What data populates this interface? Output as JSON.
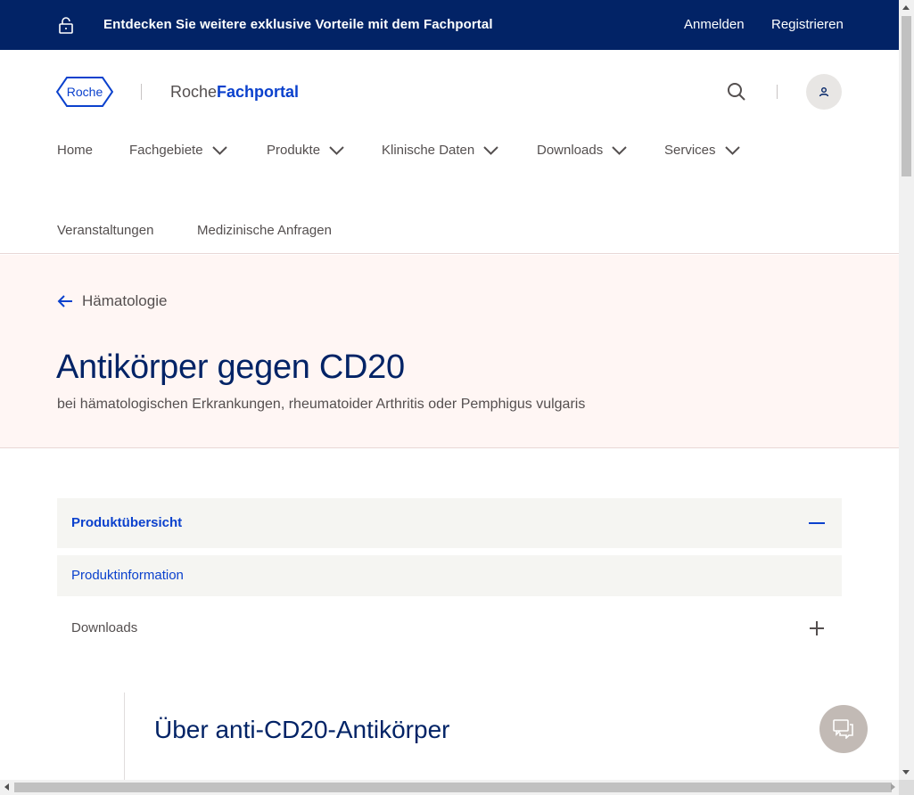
{
  "topbar": {
    "promo": "Entdecken Sie weitere exklusive Vorteile mit dem Fachportal",
    "login": "Anmelden",
    "register": "Registrieren"
  },
  "header": {
    "logo_text": "Roche",
    "brand_prefix": "Roche",
    "brand_suffix": "Fachportal",
    "nav": [
      {
        "label": "Home",
        "dropdown": false
      },
      {
        "label": "Fachgebiete",
        "dropdown": true
      },
      {
        "label": "Produkte",
        "dropdown": true
      },
      {
        "label": "Klinische Daten",
        "dropdown": true
      },
      {
        "label": "Downloads",
        "dropdown": true
      },
      {
        "label": "Services",
        "dropdown": true
      }
    ],
    "nav_second_row": [
      {
        "label": "Veranstaltungen"
      },
      {
        "label": "Medizinische Anfragen"
      }
    ]
  },
  "hero": {
    "back_label": "Hämatologie",
    "title": "Antikörper gegen CD20",
    "subtitle": "bei hämatologischen Erkrankungen, rheumatoider Arthritis oder Pemphigus vulgaris"
  },
  "accordion": {
    "overview_label": "Produktübersicht",
    "overview_link": "Produktinformation",
    "downloads_label": "Downloads"
  },
  "content": {
    "section_title": "Über anti-CD20-Antikörper"
  },
  "colors": {
    "navy": "#022366",
    "blue": "#0b41cd",
    "hero_bg": "#fff6f4",
    "accordion_bg": "#f5f5f2",
    "text": "#544f4f"
  }
}
